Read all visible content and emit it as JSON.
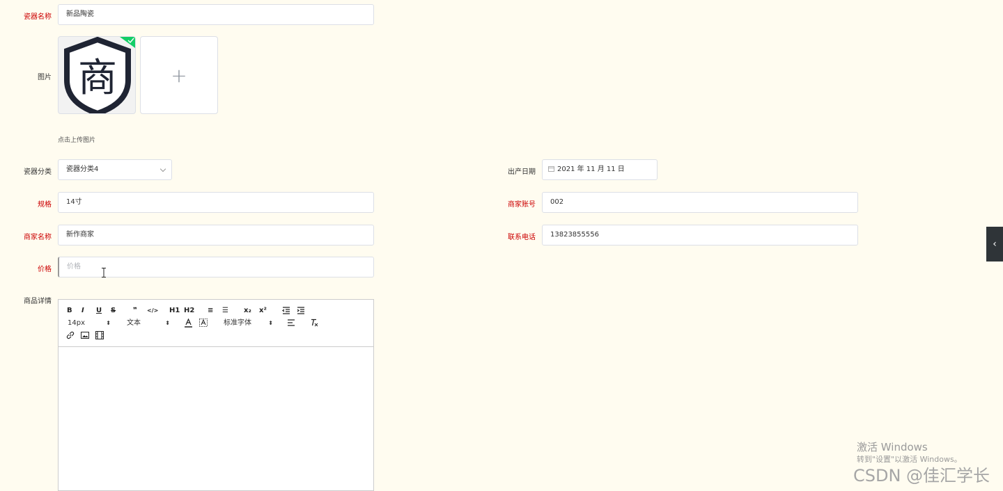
{
  "form": {
    "name": {
      "label": "瓷器名称",
      "value": "新品陶瓷"
    },
    "image": {
      "label": "图片",
      "hint": "点击上传图片",
      "logo_char": "商"
    },
    "category": {
      "label": "瓷器分类",
      "value": "瓷器分类4"
    },
    "date": {
      "label": "出产日期",
      "value": "2021 年 11 月 11 日"
    },
    "spec": {
      "label": "规格",
      "value": "14寸"
    },
    "merchant_account": {
      "label": "商家账号",
      "value": "002"
    },
    "merchant_name": {
      "label": "商家名称",
      "value": "新作商家"
    },
    "phone": {
      "label": "联系电话",
      "value": "13823855556"
    },
    "price": {
      "label": "价格",
      "placeholder": "价格"
    },
    "detail": {
      "label": "商品详情"
    }
  },
  "editor": {
    "font_size": "14px",
    "header_select": "文本",
    "font_family": "标准字体",
    "buttons": [
      "B",
      "I",
      "U",
      "S",
      "❞",
      "</>",
      "H1",
      "H2",
      "≡",
      "☰",
      "x₂",
      "x²"
    ]
  },
  "watermark": {
    "line1": "激活 Windows",
    "line2": "转到\"设置\"以激活 Windows。",
    "csdn": "CSDN @佳汇学长"
  },
  "colors": {
    "required": "#cc0000",
    "background": "#fffcf0",
    "upload_ok": "#13ce66"
  },
  "icons": [
    "check-icon",
    "plus-icon",
    "calendar-icon",
    "chevron-down-icon",
    "collapse-left-icon",
    "text-cursor-icon"
  ]
}
